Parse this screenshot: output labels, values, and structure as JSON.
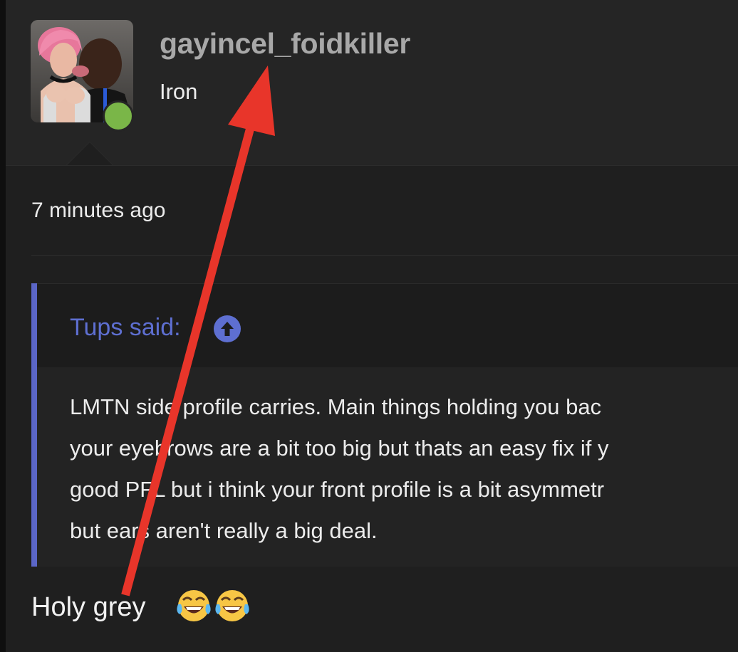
{
  "post": {
    "username": "gayincel_foidkiller",
    "user_title": "Iron",
    "timestamp": "7 minutes ago",
    "quote": {
      "attribution": "Tups said:",
      "lines": [
        "LMTN side profile carries. Main things holding you bac",
        "your eyebrows are a bit too big but thats an easy fix if y",
        "good PFL but i think your front profile is a bit asymmetr",
        "but ears aren't really a big deal."
      ]
    },
    "reply": {
      "text": "Holy grey",
      "emojis": [
        "face-with-tears-of-joy",
        "face-with-tears-of-joy"
      ]
    }
  },
  "colors": {
    "background": "#1f1f1f",
    "header": "#252525",
    "username": "#a8a8a8",
    "quote_accent": "#5e6fd1",
    "online": "#7ab648",
    "annotation_arrow": "#e8352a"
  },
  "icons": {
    "online_status": "online-dot-icon",
    "quote_jump": "arrow-up-circle-icon",
    "annotation": "red-arrow-annotation-icon"
  }
}
